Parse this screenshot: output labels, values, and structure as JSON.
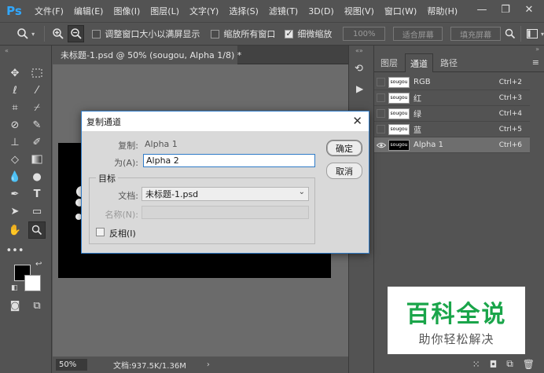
{
  "app": {
    "logo": "Ps"
  },
  "menu": [
    "文件(F)",
    "编辑(E)",
    "图像(I)",
    "图层(L)",
    "文字(Y)",
    "选择(S)",
    "滤镜(T)",
    "3D(D)",
    "视图(V)",
    "窗口(W)",
    "帮助(H)"
  ],
  "window_controls": {
    "minimize": "—",
    "restore": "❐",
    "close": "✕"
  },
  "options": {
    "resize_windows": "调整窗口大小以满屏显示",
    "zoom_all": "缩放所有窗口",
    "scrubby_zoom": "细微缩放",
    "zoom_percent": "100%",
    "fit_screen": "适合屏幕",
    "fill_screen": "填充屏幕"
  },
  "document": {
    "tab_title": "未标题-1.psd @ 50% (sougou, Alpha 1/8) *",
    "status_zoom": "50%",
    "status_doc": "文档:937.5K/1.36M"
  },
  "panel": {
    "tabs": [
      "图层",
      "通道",
      "路径"
    ],
    "active_tab": "通道",
    "channels": [
      {
        "name": "RGB",
        "shortcut": "Ctrl+2",
        "thumb": "sougou",
        "visible": false,
        "selected": false
      },
      {
        "name": "红",
        "shortcut": "Ctrl+3",
        "thumb": "sougou",
        "visible": false,
        "selected": false
      },
      {
        "name": "绿",
        "shortcut": "Ctrl+4",
        "thumb": "sougou",
        "visible": false,
        "selected": false
      },
      {
        "name": "蓝",
        "shortcut": "Ctrl+5",
        "thumb": "sougou",
        "visible": false,
        "selected": false
      },
      {
        "name": "Alpha 1",
        "shortcut": "Ctrl+6",
        "thumb": "sougou",
        "visible": true,
        "selected": true
      }
    ]
  },
  "dialog": {
    "title": "复制通道",
    "source_label": "复制:",
    "source_value": "Alpha 1",
    "as_label": "为(A):",
    "as_value": "Alpha 2",
    "target_label": "目标",
    "document_label": "文档:",
    "document_value": "未标题-1.psd",
    "name_label": "名称(N):",
    "name_value": "",
    "invert_label": "反相(I)",
    "invert_checked": false,
    "ok_label": "确定",
    "cancel_label": "取消",
    "close_glyph": "✕"
  },
  "watermark": {
    "main": "百科全说",
    "sub": "助你轻松解决"
  },
  "colors": {
    "accent": "#2f7bc7",
    "ps_blue": "#31a8ff",
    "watermark_green": "#1aa54a"
  }
}
